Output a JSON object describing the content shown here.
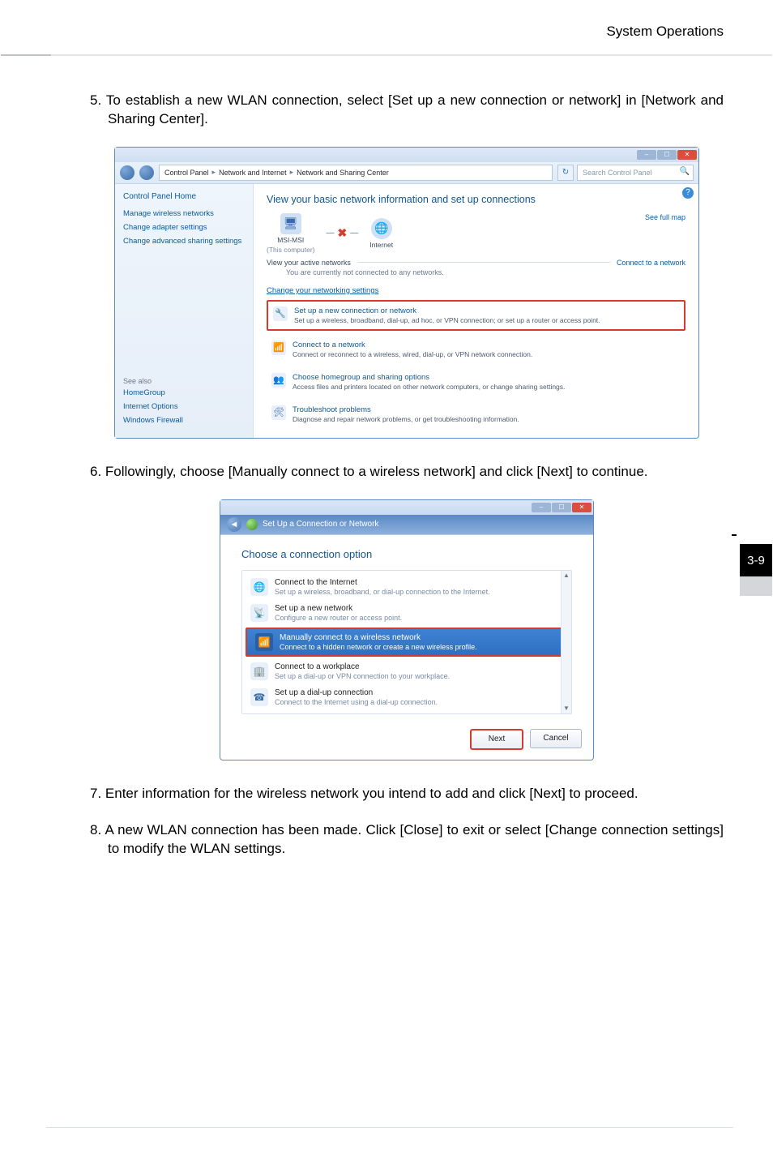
{
  "page": {
    "header": "System Operations",
    "side_tab": "3-9"
  },
  "steps": {
    "s5": "5. To establish a new WLAN connection, select [Set up a new connection or network] in [Network and Sharing Center].",
    "s6": "6. Followingly, choose [Manually connect to a wireless network] and click [Next] to continue.",
    "s7": "7. Enter information for the wireless network you intend to add and click [Next] to proceed.",
    "s8": "8. A new WLAN connection has been made. Click [Close] to exit or select [Change connection settings] to modify the WLAN settings."
  },
  "cp": {
    "breadcrumb": {
      "root": "Control Panel",
      "cat": "Network and Internet",
      "leaf": "Network and Sharing Center"
    },
    "search_placeholder": "Search Control Panel",
    "title": "View your basic network information and set up connections",
    "see_full_map": "See full map",
    "pc_name": "MSI-MSI",
    "pc_sub": "(This computer)",
    "internet": "Internet",
    "view_active": "View your active networks",
    "connect_to_network": "Connect to a network",
    "not_connected": "You are currently not connected to any networks.",
    "change_settings": "Change your networking settings",
    "side": {
      "home": "Control Panel Home",
      "l1": "Manage wireless networks",
      "l2": "Change adapter settings",
      "l3": "Change advanced sharing settings",
      "seealso": "See also",
      "sa1": "HomeGroup",
      "sa2": "Internet Options",
      "sa3": "Windows Firewall"
    },
    "opts": {
      "o1t": "Set up a new connection or network",
      "o1d": "Set up a wireless, broadband, dial-up, ad hoc, or VPN connection; or set up a router or access point.",
      "o2t": "Connect to a network",
      "o2d": "Connect or reconnect to a wireless, wired, dial-up, or VPN network connection.",
      "o3t": "Choose homegroup and sharing options",
      "o3d": "Access files and printers located on other network computers, or change sharing settings.",
      "o4t": "Troubleshoot problems",
      "o4d": "Diagnose and repair network problems, or get troubleshooting information."
    }
  },
  "wiz": {
    "window_title": "Set Up a Connection or Network",
    "heading": "Choose a connection option",
    "items": {
      "i1t": "Connect to the Internet",
      "i1d": "Set up a wireless, broadband, or dial-up connection to the Internet.",
      "i2t": "Set up a new network",
      "i2d": "Configure a new router or access point.",
      "i3t": "Manually connect to a wireless network",
      "i3d": "Connect to a hidden network or create a new wireless profile.",
      "i4t": "Connect to a workplace",
      "i4d": "Set up a dial-up or VPN connection to your workplace.",
      "i5t": "Set up a dial-up connection",
      "i5d": "Connect to the Internet using a dial-up connection."
    },
    "buttons": {
      "next": "Next",
      "cancel": "Cancel"
    }
  }
}
